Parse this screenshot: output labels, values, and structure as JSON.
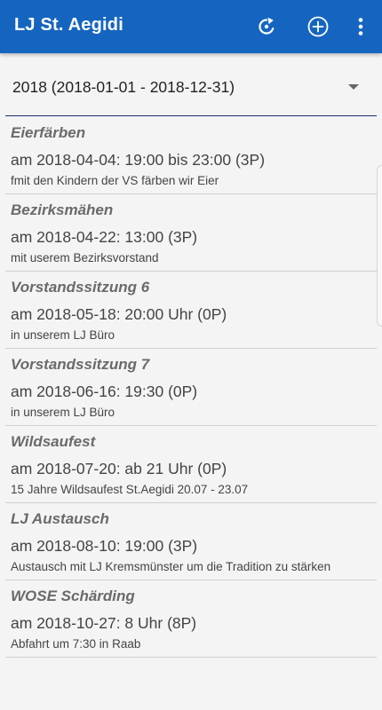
{
  "app_bar": {
    "title": "LJ St. Aegidi",
    "color": "#1565c0",
    "actions": [
      {
        "icon": "refresh-icon"
      },
      {
        "icon": "add-circle-icon"
      },
      {
        "icon": "more-vert-icon"
      }
    ]
  },
  "year_select": {
    "value": "2018 (2018-01-01 - 2018-12-31)"
  },
  "events": [
    {
      "title": "Eierfärben",
      "date": "am 2018-04-04: 19:00 bis 23:00 (3P)",
      "description": "fmit den Kindern der VS färben wir Eier"
    },
    {
      "title": "Bezirksmähen",
      "date": "am 2018-04-22: 13:00 (3P)",
      "description": "mit userem Bezirksvorstand"
    },
    {
      "title": "Vorstandssitzung 6",
      "date": "am 2018-05-18: 20:00 Uhr (0P)",
      "description": "in unserem LJ Büro"
    },
    {
      "title": "Vorstandssitzung 7",
      "date": "am 2018-06-16: 19:30 (0P)",
      "description": "in unserem LJ Büro"
    },
    {
      "title": "Wildsaufest",
      "date": "am 2018-07-20: ab 21 Uhr (0P)",
      "description": "15 Jahre Wildsaufest St.Aegidi 20.07 - 23.07"
    },
    {
      "title": "LJ Austausch",
      "date": "am 2018-08-10: 19:00 (3P)",
      "description": "Austausch mit LJ Kremsmünster um die Tradition zu stärken"
    },
    {
      "title": "WOSE Schärding",
      "date": "am 2018-10-27: 8 Uhr (8P)",
      "description": "Abfahrt um 7:30 in Raab"
    }
  ]
}
